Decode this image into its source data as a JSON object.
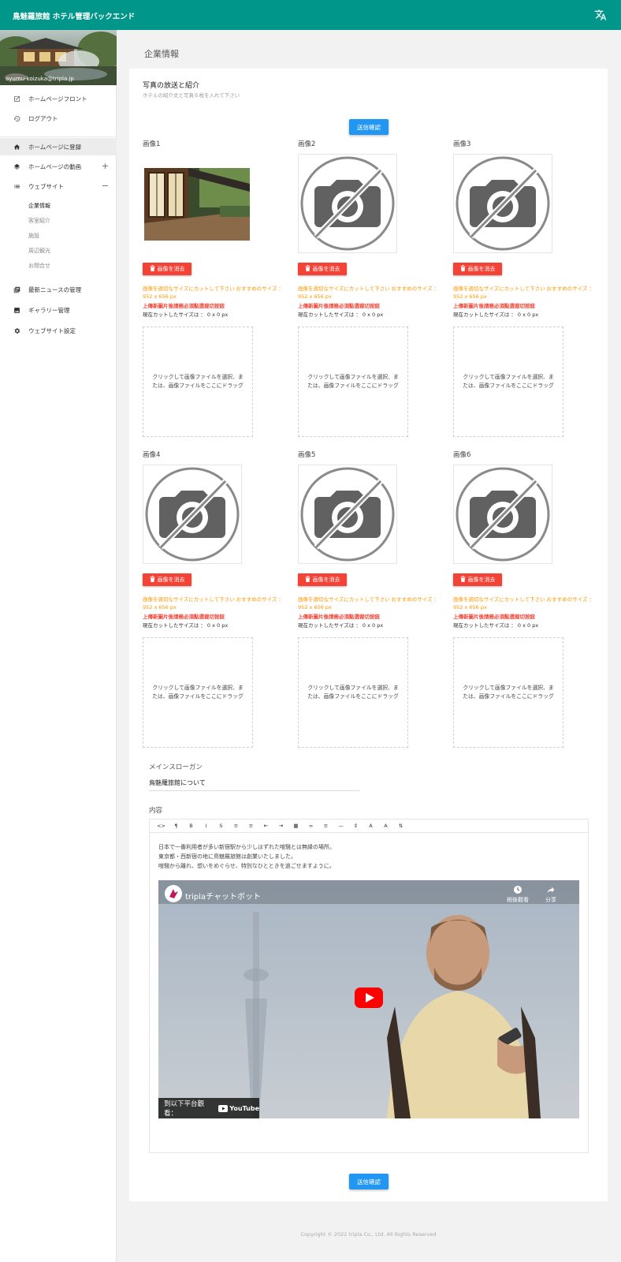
{
  "app": {
    "title": "鳥魅羅旅館 ホテル管理バックエンド"
  },
  "user": {
    "email": "ayumu-koizuka@tripla.jp"
  },
  "sidebar": {
    "items": [
      {
        "label": "ホームページフロント",
        "icon": "external-link-icon"
      },
      {
        "label": "ログアウト",
        "icon": "history-icon"
      },
      {
        "label": "ホームページに登録",
        "icon": "home-icon"
      },
      {
        "label": "ホームページの動画",
        "icon": "layers-icon",
        "toggle": "+"
      },
      {
        "label": "ウェブサイト",
        "icon": "list-icon",
        "toggle": "−"
      },
      {
        "label": "最新ニュースの管理",
        "icon": "news-icon"
      },
      {
        "label": "ギャラリー管理",
        "icon": "image-icon"
      },
      {
        "label": "ウェブサイト設定",
        "icon": "gear-icon"
      }
    ],
    "submenu": [
      "企業情報",
      "客室紹介",
      "施設",
      "周辺観光",
      "お問合せ"
    ]
  },
  "page": {
    "heading": "企業情報",
    "section_title": "写真の放送と紹介",
    "section_subtitle": "ホテルの紹介文と写真６枚を入れて下さい",
    "submit_label": "送信確認"
  },
  "images": [
    {
      "label": "画像1",
      "has_photo": true
    },
    {
      "label": "画像2",
      "has_photo": false
    },
    {
      "label": "画像3",
      "has_photo": false
    },
    {
      "label": "画像4",
      "has_photo": false
    },
    {
      "label": "画像5",
      "has_photo": false
    },
    {
      "label": "画像6",
      "has_photo": false
    }
  ],
  "image_card": {
    "delete_label": "画像を消去",
    "hint_orange": "画像を適切なサイズにカットして下さい おすすめのサイズ ： 952 x 656 px",
    "hint_red": "上傳新圖片後請務必須點選裁切按鈕",
    "cut_size": "現在カットしたサイズは ： 0 x 0 px",
    "dropzone_text": "クリックして画像ファイルを選択、または、画像ファイルをここにドラッグ"
  },
  "slogan": {
    "label": "メインスローガン",
    "value": "鳥魅羅旅館について"
  },
  "content": {
    "label": "内容",
    "toolbar": [
      "<>",
      "¶",
      "B",
      "I",
      "S",
      "≡",
      "≡",
      "⇤",
      "⇥",
      "▦",
      "∞",
      "≡",
      "—",
      "⇕",
      "A",
      "A",
      "⇅"
    ],
    "lines": [
      "日本で一番利用者が多い新宿駅から少しはずれた喧騒とは無縁の場所。",
      "東京都・西新宿の地に鳥魅羅旅館は創業いたしました。",
      "喧騒から離れ、想いをめぐらせ、特別なひとときを過ごせますように。"
    ],
    "video": {
      "title": "triplaチャットボット",
      "watch_later": "稍後觀看",
      "share": "分享",
      "watch_on": "到以下平台觀看：",
      "platform": "YouTube"
    }
  },
  "footer": {
    "copyright": "Copyright © 2022 tripla Co., Ltd. All Rights Reserved"
  },
  "colors": {
    "topbar": "#00968a",
    "primary": "#2196f3",
    "danger": "#f44336",
    "warning": "#ff9800"
  }
}
